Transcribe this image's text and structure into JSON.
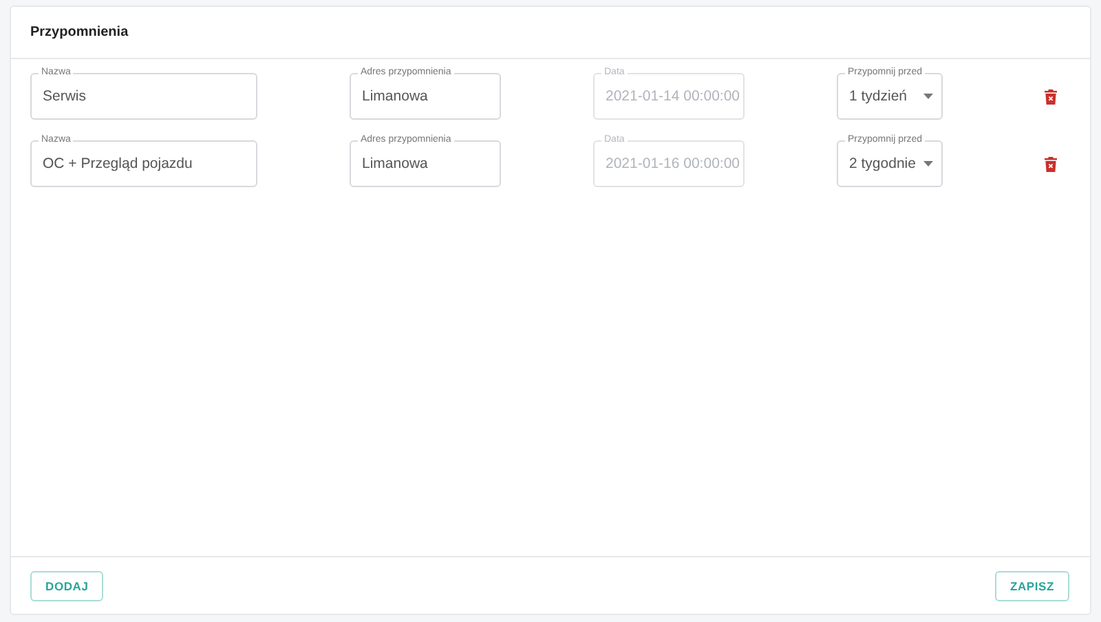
{
  "card": {
    "title": "Przypomnienia"
  },
  "reminders": [
    {
      "name": {
        "label": "Nazwa",
        "value": "Serwis"
      },
      "address": {
        "label": "Adres przypomnienia",
        "value": "Limanowa"
      },
      "date": {
        "label": "Data",
        "value": "2021-01-14 00:00:00",
        "disabled": true
      },
      "remind_before": {
        "label": "Przypomnij przed",
        "value": "1 tydzień"
      }
    },
    {
      "name": {
        "label": "Nazwa",
        "value": "OC + Przegląd pojazdu"
      },
      "address": {
        "label": "Adres przypomnienia",
        "value": "Limanowa"
      },
      "date": {
        "label": "Data",
        "value": "2021-01-16 00:00:00",
        "disabled": true
      },
      "remind_before": {
        "label": "Przypomnij przed",
        "value": "2 tygodnie"
      }
    }
  ],
  "buttons": [
    {
      "label": "DODAJ"
    },
    {
      "label": "ZAPISZ"
    }
  ]
}
